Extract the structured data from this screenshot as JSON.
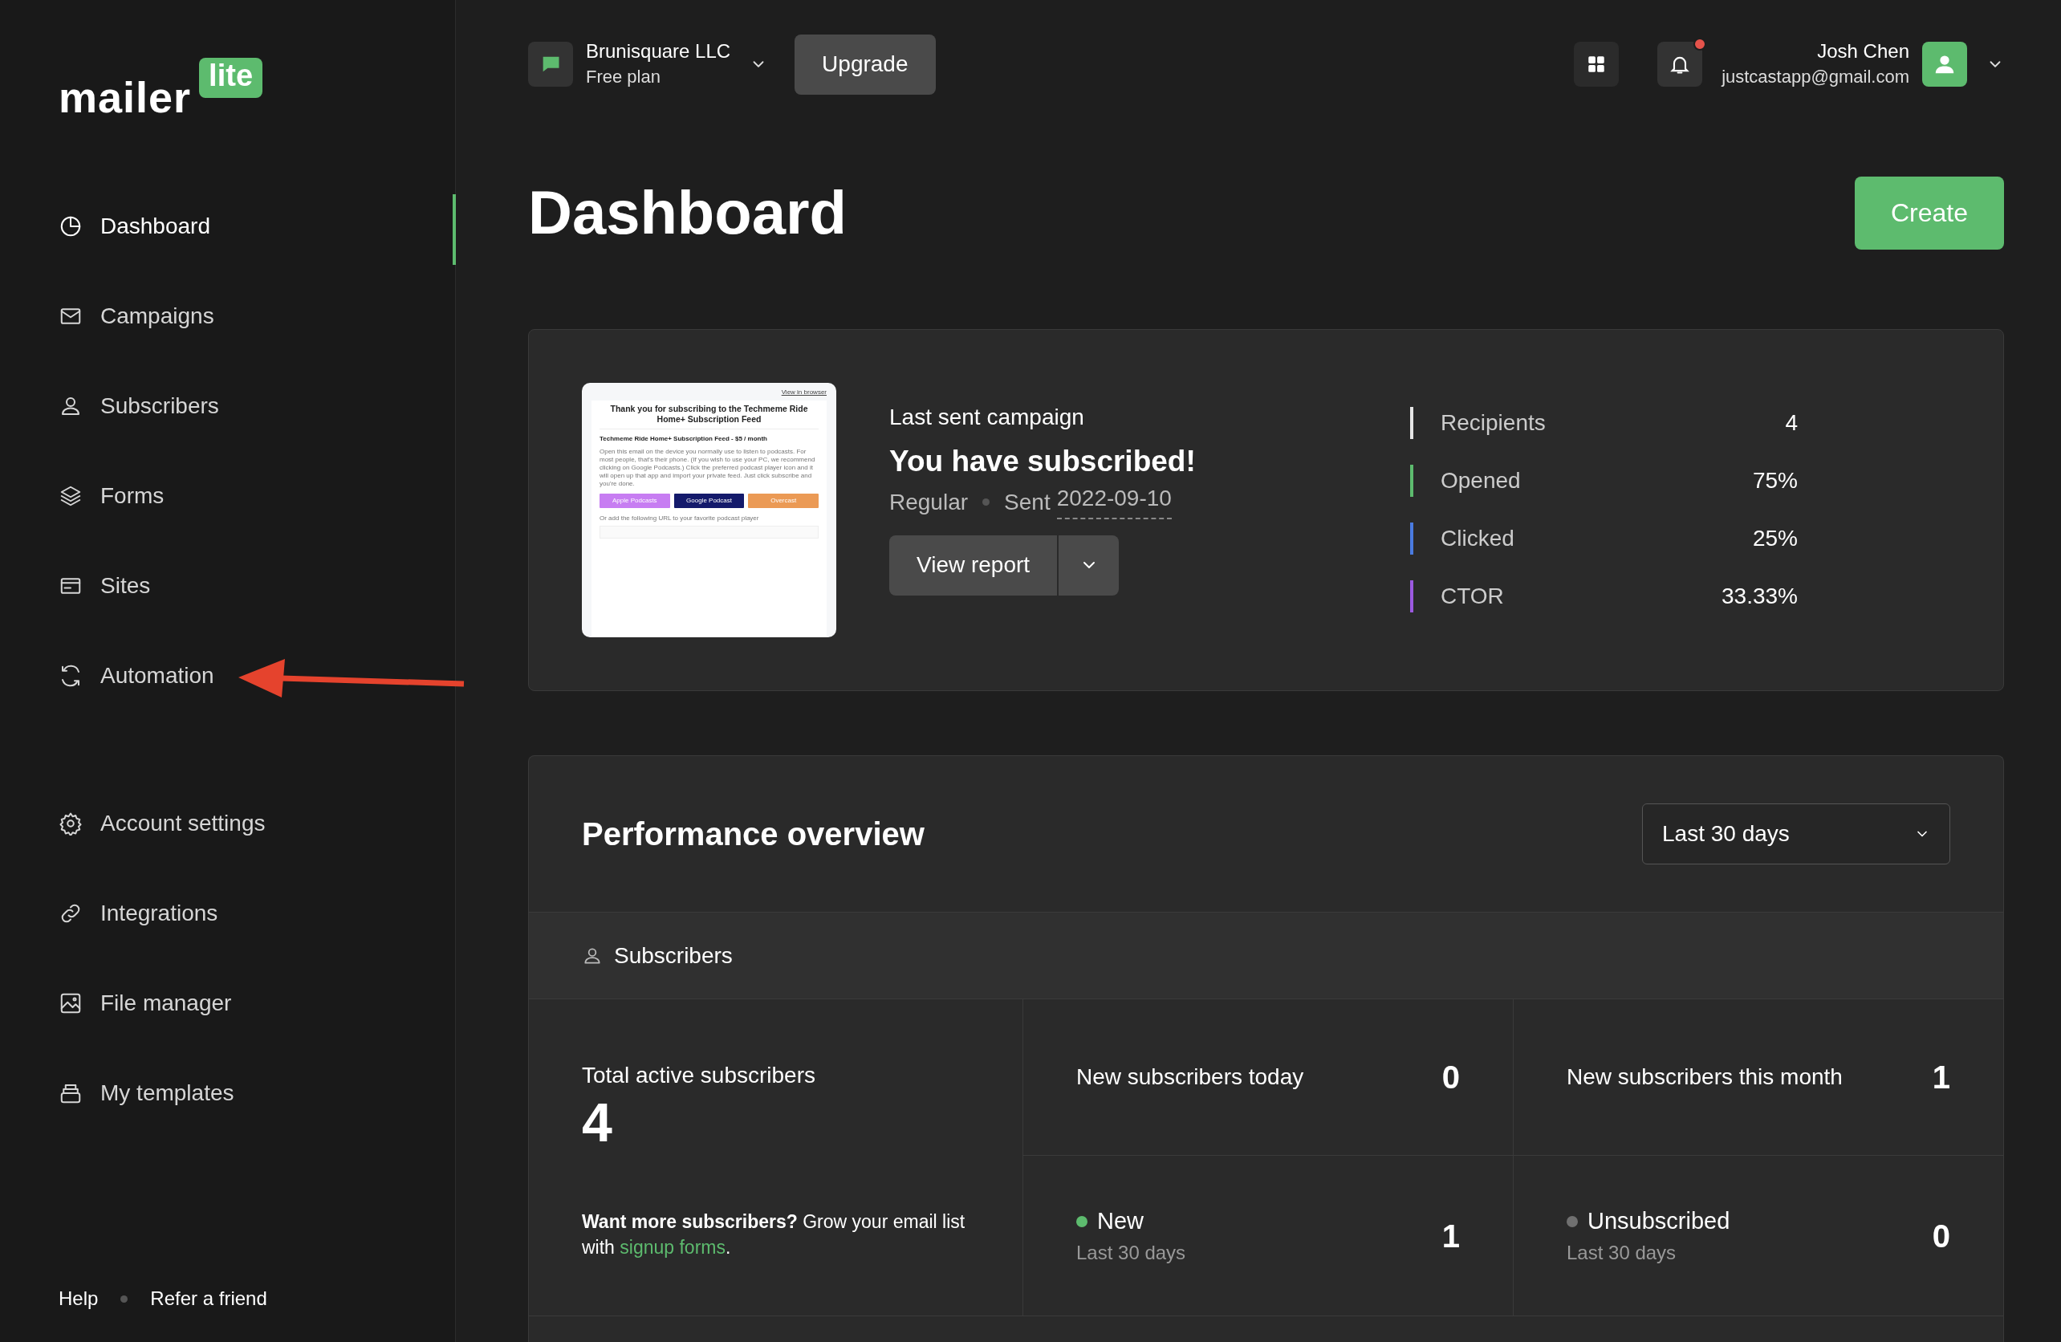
{
  "logo": {
    "word": "mailer",
    "badge": "lite"
  },
  "sidebar": {
    "items": [
      {
        "label": "Dashboard",
        "selected": true
      },
      {
        "label": "Campaigns",
        "selected": false
      },
      {
        "label": "Subscribers",
        "selected": false
      },
      {
        "label": "Forms",
        "selected": false
      },
      {
        "label": "Sites",
        "selected": false
      },
      {
        "label": "Automation",
        "selected": false
      }
    ],
    "settings_items": [
      {
        "label": "Account settings",
        "selected": false
      },
      {
        "label": "Integrations",
        "selected": false
      },
      {
        "label": "File manager",
        "selected": false
      },
      {
        "label": "My templates",
        "selected": false
      }
    ],
    "footer_links": [
      "Help",
      "Refer a friend"
    ]
  },
  "account": {
    "name": "Brunisquare LLC",
    "plan": "Free plan"
  },
  "upgrade_button": "Upgrade",
  "notifications": {
    "unread": true
  },
  "user": {
    "name": "Josh Chen",
    "email": "justcastapp@gmail.com"
  },
  "page_title": "Dashboard",
  "create_button": "Create",
  "campaign": {
    "caption": "Last sent campaign",
    "title": "You have subscribed!",
    "type": "Regular",
    "sent_label": "Sent",
    "sent_date": "2022-09-10",
    "button": "View report",
    "preview": {
      "browser_link": "View in browser",
      "heading": "Thank you for subscribing to the Techmeme Ride Home+ Subscription Feed",
      "subheading": "Techmeme Ride Home+ Subscription Feed - $5 / month",
      "body": "Open this email on the device you normally use to listen to podcasts. For most people, that's their phone. (If you wish to use your PC, we recommend clicking on Google Podcasts.) Click the preferred podcast player icon and it will open up that app and import your private feed. Just click subscribe and you're done.",
      "buttons": [
        {
          "label": "Apple Podcasts",
          "color": "#c77df2"
        },
        {
          "label": "Google Podcast",
          "color": "#141a6b"
        },
        {
          "label": "Overcast",
          "color": "#eb9a55"
        }
      ],
      "url_hint": "Or add the following URL to your favorite podcast player"
    },
    "stats": [
      {
        "label": "Recipients",
        "value": "4",
        "color": "#e6e6e6"
      },
      {
        "label": "Opened",
        "value": "75%",
        "color": "#5dbb6e"
      },
      {
        "label": "Clicked",
        "value": "25%",
        "color": "#4a7be0"
      },
      {
        "label": "CTOR",
        "value": "33.33%",
        "color": "#9b59e0"
      }
    ]
  },
  "performance": {
    "title": "Performance overview",
    "period": "Last 30 days",
    "section": "Subscribers",
    "total": {
      "label": "Total active subscribers",
      "value": "4",
      "note": "**Want more subscribers?** Grow your email list with",
      "link": "signup forms",
      "note_end": "."
    },
    "cards": [
      {
        "label": "New subscribers today",
        "value": "0"
      },
      {
        "label": "New subscribers this month",
        "value": "1"
      }
    ],
    "breakdown": [
      {
        "label": "New",
        "sub": "Last 30 days",
        "value": "1",
        "color": "#5dbb6e"
      },
      {
        "label": "Unsubscribed",
        "sub": "Last 30 days",
        "value": "0",
        "color": "#707070"
      }
    ]
  }
}
